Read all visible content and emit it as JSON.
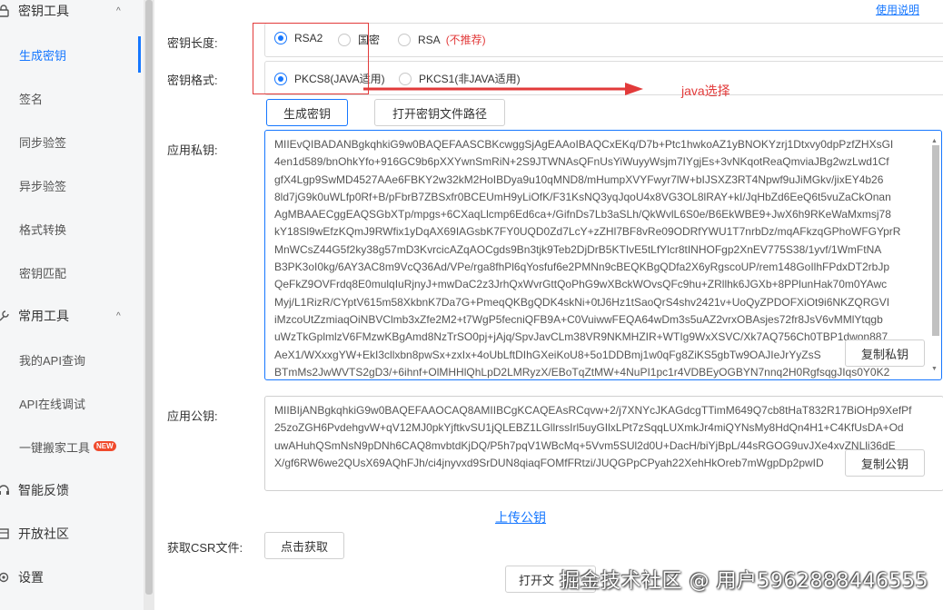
{
  "help_link": "使用说明",
  "sidebar": {
    "groups": [
      {
        "label": "密钥工具",
        "icon": "lock-icon"
      },
      {
        "label": "常用工具",
        "icon": "wrench-icon"
      }
    ],
    "items": [
      {
        "label": "生成密钥",
        "active": true
      },
      {
        "label": "签名"
      },
      {
        "label": "同步验签"
      },
      {
        "label": "异步验签"
      },
      {
        "label": "格式转换"
      },
      {
        "label": "密钥匹配"
      },
      {
        "label": "我的API查询"
      },
      {
        "label": "API在线调试"
      },
      {
        "label": "一键搬家工具",
        "badge": "NEW"
      }
    ],
    "bottom": [
      {
        "label": "智能反馈",
        "icon": "headset-icon"
      },
      {
        "label": "开放社区",
        "icon": "community-icon"
      },
      {
        "label": "设置",
        "icon": "gear-icon"
      }
    ]
  },
  "form": {
    "key_length_label": "密钥长度:",
    "key_length_options": [
      "RSA2",
      "国密",
      "RSA"
    ],
    "key_length_note": "(不推荐)",
    "key_length_selected": "RSA2",
    "key_format_label": "密钥格式:",
    "key_format_options": [
      "PKCS8(JAVA适用)",
      "PKCS1(非JAVA适用)"
    ],
    "key_format_selected": "PKCS8(JAVA适用)",
    "generate_button": "生成密钥",
    "open_path_button": "打开密钥文件路径",
    "private_key_label": "应用私钥:",
    "private_key_lines": [
      "MIIEvQIBADANBgkqhkiG9w0BAQEFAASCBKcwggSjAgEAAoIBAQCxEKq/D7b+Ptc1hwkoAZ1yBNOKYzrj1Dtxvy0dpPzfZHXsGI",
      "4en1d589/bnOhkYfo+916GC9b6pXXYwnSmRiN+2S9JTWNAsQFnUsYiWuyyWsjm7IYgjEs+3vNKqotReaQmviaJBg2wzLwd1Cf",
      "gfX4Lgp9SwMD4527AAe6FBKY2w32kM2HoIBDya9u10qMND8/mHumpXVYFwyr7lW+bIJSXZ3RT4Npwf9uJiMGkv/jixEY4b26",
      "8ld7jG9k0uWLfp0Rf+B/pFbrB7ZBSxfr0BCEUmH9yLiOfK/F31KsNQ3yqJqoU4x8VG3OL8lRAY+kI/JqHbZd6EeQ6t5vuZaCkOnan",
      "AgMBAAECggEAQSGbXTp/mpgs+6CXaqLlcmp6Ed6ca+/GifnDs7Lb3aSLh/QkWvlL6S0e/B6EkWBE9+JwX6h9RKeWaMxmsj78",
      "kY18Sl9wEfzKQmJ9RWfix1yDqAX69IAGsbK7FY0UQD0Zd7LcY+zZHl7BF8vRe09ODRfYWU1T7nrbDz/mqAFkzqGPhoWFGYprR",
      "MnWCsZ44G5f2ky38g57mD3KvrcicAZqAOCgds9Bn3tjk9Teb2DjDrB5KTIvE5tLfYlcr8tINHOFgp2XnEV775S38/1yvf/1WmFtNA",
      "B3PK3oI0kg/6AY3AC8m9VcQ36Ad/VPe/rga8fhPl6qYosfuf6e2PMNn9cBEQKBgQDfa2X6yRgscoUP/rem148GoIlhFPdxDT2rbJp",
      "QeFkZ9OVFrdq8E0mulqIuRjnyJ+mwDaC2z3JrhQxWvrGttQoPhG9wXBckWOvsQFc9hu+ZRllhk6JGXb+8PPlunHak70m0YAwc",
      "Myj/L1RizR/CYptV615m58XkbnK7Da7G+PmeqQKBgQDK4skNi+0tJ6Hz1tSaoQrS4shv2421v+UoQyZPDOFXiOt9i6NKZQRGVI",
      "iMzcoUtZzmiaqOiNBVClmb3xZfe2M2+t7WgP5fecniQFB9A+C0VuiwwFEQA64wDm3s5uAZ2vrxOBAsjes72fr8JsV6vMMlYtqgb",
      "uWzTkGplmlzV6FMzwKBgAmd8NzTrSO0pj+jAjq/SpvJavCLm38VR9NKMHZIR+WTIg9WxXSVC/Xk7AQ756Ch0TBP1dwon887",
      "AeX1/WXxxgYW+EkI3cllxbn8pwSx+zxIx+4oUbLftDIhGXeiKoU8+5o1DDBmj1w0qFg8ZiKS5gbTw9OAJIeJrYyZsS",
      "BTmMs2JwWVTS2gD3/+6ihnf+OlMHHlQhLpD2LMRyzX/EBoTqZtMW+4NuPI1pc1r4VDBEyOGBYN7nnq2H0RgfsqgJIqs0Y0K2"
    ],
    "copy_private_button": "复制私钥",
    "public_key_label": "应用公钥:",
    "public_key_lines": [
      "MIIBIjANBgkqhkiG9w0BAQEFAAOCAQ8AMIIBCgKCAQEAsRCqvw+2/j7XNYcJKAGdcgTTimM649Q7cb8tHaT832R17BiOHp9XefPf",
      "25zoZGH6PvdehgvW+qV12MJ0pkYjftkvSU1jQLEBZ1LGllrssIrl5uyGIlxLPt7zSqqLUXmkJr4miQYNsMy8HdQn4H1+C4KfUsDA+Od",
      "uwAHuhQSmNsN9pDNh6CAQ8mvbtdKjDQ/P5h7pqV1WBcMq+5Vvm5SUl2d0U+DacH/biYjBpL/44sRGOG9uvJXe4xvZNLli36dE",
      "X/gf6RW6we2QUsX69AQhFJh/ci4jnyvxd9SrDUN8qiaqFOMfFRtzi/JUQGPpCPyah22XehHkOreb7mWgpDp2pwID"
    ],
    "copy_public_button": "复制公钥",
    "upload_public_link": "上传公钥",
    "csr_label": "获取CSR文件:",
    "csr_button": "点击获取",
    "bottom_button_partial": "打开文"
  },
  "annotation": {
    "arrow_label": "java选择",
    "color": "#e23a3a"
  },
  "watermark": "掘金技术社区 @ 用户5962888446555",
  "colors": {
    "accent": "#1677ff",
    "annotation": "#e23a3a"
  }
}
